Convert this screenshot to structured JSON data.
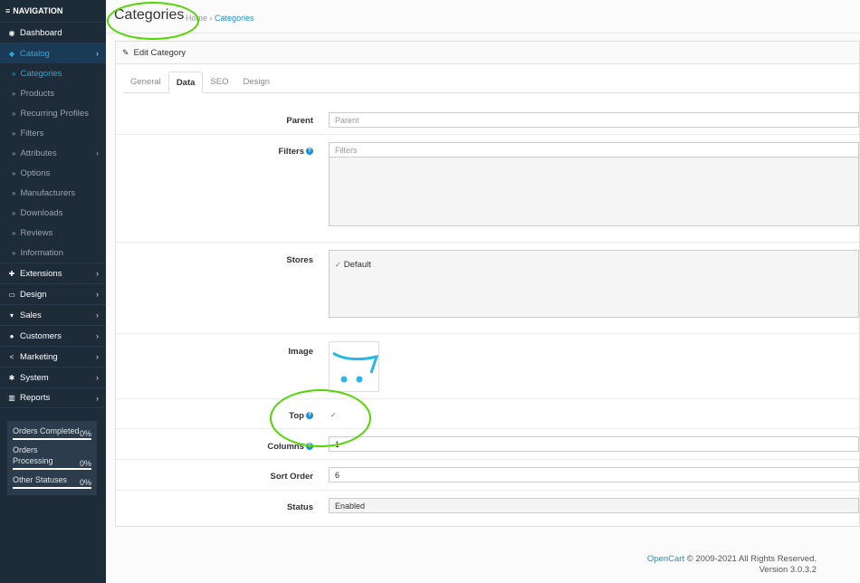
{
  "sidebar": {
    "header": "NAVIGATION",
    "items": [
      {
        "label": "Dashboard",
        "icon": "dashboard-icon"
      },
      {
        "label": "Catalog",
        "icon": "tag-icon",
        "active": true
      },
      {
        "label": "Extensions",
        "icon": "puzzle-icon"
      },
      {
        "label": "Design",
        "icon": "monitor-icon"
      },
      {
        "label": "Sales",
        "icon": "cart-icon"
      },
      {
        "label": "Customers",
        "icon": "user-icon"
      },
      {
        "label": "Marketing",
        "icon": "share-icon"
      },
      {
        "label": "System",
        "icon": "gear-icon"
      },
      {
        "label": "Reports",
        "icon": "bar-chart-icon"
      }
    ],
    "catalog_sub": [
      "Categories",
      "Products",
      "Recurring Profiles",
      "Filters",
      "Attributes",
      "Options",
      "Manufacturers",
      "Downloads",
      "Reviews",
      "Information"
    ],
    "stats": [
      {
        "label": "Orders Completed",
        "pct": "0%"
      },
      {
        "label": "Orders Processing",
        "pct": "0%"
      },
      {
        "label": "Other Statuses",
        "pct": "0%"
      }
    ]
  },
  "header": {
    "title": "Categories",
    "breadcrumb_home": "Home",
    "breadcrumb_sep": "›",
    "breadcrumb_current": "Categories"
  },
  "panel": {
    "title": "Edit Category",
    "tabs": [
      "General",
      "Data",
      "SEO",
      "Design"
    ],
    "active_tab": "Data"
  },
  "form": {
    "parent_label": "Parent",
    "parent_placeholder": "Parent",
    "filters_label": "Filters",
    "filters_placeholder": "Filters",
    "stores_label": "Stores",
    "stores_default": "Default",
    "image_label": "Image",
    "top_label": "Top",
    "columns_label": "Columns",
    "columns_value": "1",
    "sort_order_label": "Sort Order",
    "sort_order_value": "6",
    "status_label": "Status",
    "status_value": "Enabled"
  },
  "footer": {
    "brand": "OpenCart",
    "copyright": "© 2009-2021 All Rights Reserved.",
    "version": "Version 3.0.3.2"
  },
  "colors": {
    "sidebar_bg": "#1e2b38",
    "accent": "#1e91cf",
    "annotation": "#52d600"
  }
}
